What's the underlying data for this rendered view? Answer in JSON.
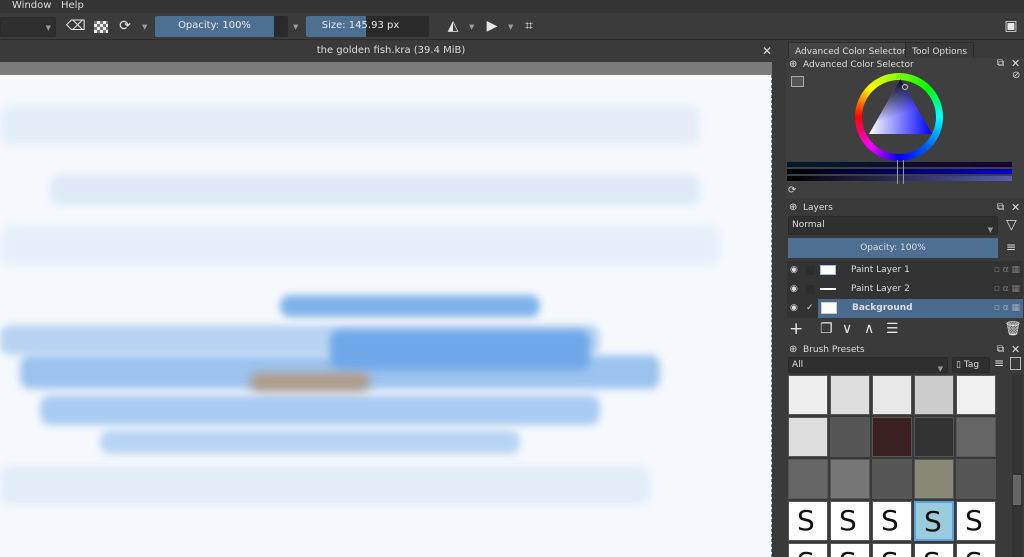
{
  "menu": {
    "items": [
      {
        "label": "Window"
      },
      {
        "label": "Help"
      }
    ]
  },
  "toolbar": {
    "opacity": "Opacity: 100%",
    "opacity_value": 100,
    "size": "Size: 145.93 px",
    "size_fill_percent": 55
  },
  "document": {
    "title": "the golden fish.kra (39.4 MiB)"
  },
  "dock": {
    "tabs": [
      {
        "label": "Advanced Color Selector"
      },
      {
        "label": "Tool Options"
      }
    ],
    "color_selector": {
      "title": "Advanced Color Selector"
    },
    "layers": {
      "title": "Layers",
      "blend_mode": "Normal",
      "opacity": "Opacity:  100%",
      "items": [
        {
          "name": "Paint Layer 1",
          "selected": false
        },
        {
          "name": "Paint Layer 2",
          "selected": false
        },
        {
          "name": "Background",
          "selected": true
        }
      ]
    },
    "brushes": {
      "title": "Brush Presets",
      "filter": "All",
      "tag": "Tag"
    }
  },
  "colors": {
    "accent": "#4d6f91",
    "selected_layer": "#4a6b8d"
  }
}
